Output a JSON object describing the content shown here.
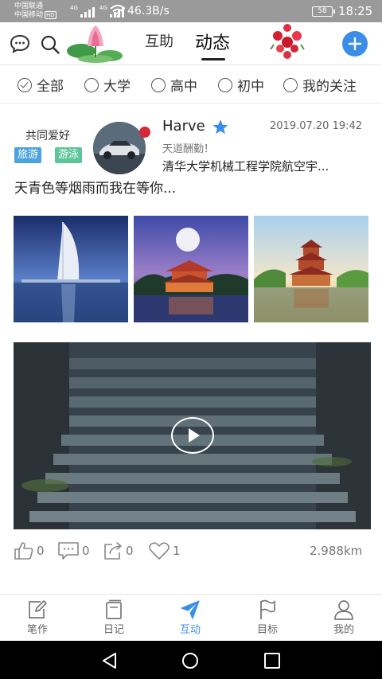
{
  "status_bar": {
    "carrier_1": "中国联通",
    "carrier_2": "中国移动",
    "carrier_2_badge": "HD",
    "network_1": "4G",
    "network_2": "4G",
    "net_speed": "46.3B/s",
    "battery": "58",
    "time": "18:25"
  },
  "header": {
    "tabs": [
      {
        "label": "互助",
        "active": false
      },
      {
        "label": "动态",
        "active": true
      }
    ],
    "icons": {
      "chat": "chat-bubble-icon",
      "search": "search-icon",
      "add": "plus-icon"
    },
    "accent_color": "#3b8ee8"
  },
  "filters": [
    {
      "label": "全部",
      "checked": true
    },
    {
      "label": "大学",
      "checked": false
    },
    {
      "label": "高中",
      "checked": false
    },
    {
      "label": "初中",
      "checked": false
    },
    {
      "label": "我的关注",
      "checked": false
    }
  ],
  "post": {
    "interest_label": "共同爱好",
    "tags": [
      {
        "label": "旅游",
        "color": "#4aa3df"
      },
      {
        "label": "游泳",
        "color": "#5cc69a"
      }
    ],
    "username": "Harve",
    "verified_icon": "star-icon",
    "datetime": "2019.07.20 19:42",
    "motto": "天道酬勤！",
    "school": "清华大学机械工程学院航空宇...",
    "content": "天青色等烟雨而我在等你...",
    "actions": [
      {
        "icon": "thumbs-up-icon",
        "count": "0"
      },
      {
        "icon": "comment-icon",
        "count": "0"
      },
      {
        "icon": "share-icon",
        "count": "0"
      },
      {
        "icon": "heart-icon",
        "count": "1"
      }
    ],
    "distance": "2.988km"
  },
  "bottom_nav": [
    {
      "label": "笔作",
      "icon": "note-edit-icon",
      "active": false
    },
    {
      "label": "日记",
      "icon": "diary-icon",
      "active": false
    },
    {
      "label": "互动",
      "icon": "paper-plane-icon",
      "active": true
    },
    {
      "label": "目标",
      "icon": "flag-icon",
      "active": false
    },
    {
      "label": "我的",
      "icon": "user-icon",
      "active": false
    }
  ]
}
